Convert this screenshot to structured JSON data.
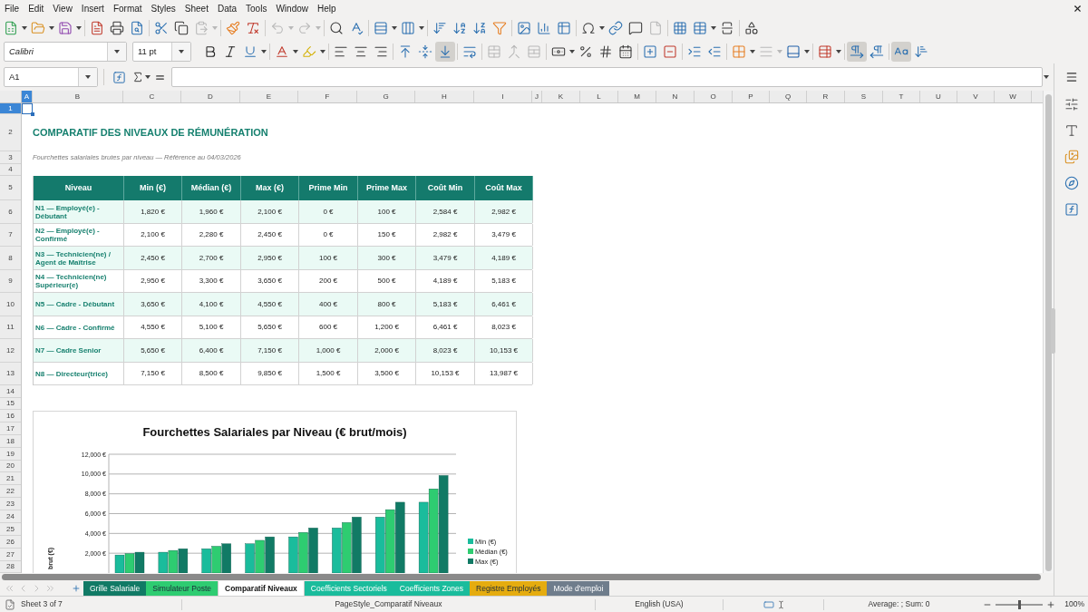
{
  "menu_bar": [
    "File",
    "Edit",
    "View",
    "Insert",
    "Format",
    "Styles",
    "Sheet",
    "Data",
    "Tools",
    "Window",
    "Help"
  ],
  "standard_toolbar": {
    "paste_disabled": true,
    "undo_disabled": true,
    "redo_disabled": true,
    "header_footer_disabled": true
  },
  "formatting_toolbar": {
    "font_name": "Calibri",
    "font_size": "11 pt",
    "merge_disabled": true,
    "border_style_disabled": true,
    "vertical_align": [
      {
        "selected": false
      },
      {
        "selected": false
      },
      {
        "selected": true
      }
    ],
    "paragraph_direction": [
      {
        "selected": true
      },
      {
        "selected": false
      }
    ],
    "text_orientation": [
      {
        "selected": true
      },
      {
        "selected": false
      }
    ]
  },
  "formula_bar": {
    "cell_reference": "A1"
  },
  "sheet": {
    "columns": [
      {
        "label": "A",
        "selected": true
      },
      {
        "label": "B",
        "selected": false
      },
      {
        "label": "C",
        "selected": false
      },
      {
        "label": "D",
        "selected": false
      },
      {
        "label": "E",
        "selected": false
      },
      {
        "label": "F",
        "selected": false
      },
      {
        "label": "G",
        "selected": false
      },
      {
        "label": "H",
        "selected": false
      },
      {
        "label": "I",
        "selected": false
      },
      {
        "label": "J",
        "selected": false
      },
      {
        "label": "K",
        "selected": false
      },
      {
        "label": "L",
        "selected": false
      },
      {
        "label": "M",
        "selected": false
      },
      {
        "label": "N",
        "selected": false
      },
      {
        "label": "O",
        "selected": false
      },
      {
        "label": "P",
        "selected": false
      },
      {
        "label": "Q",
        "selected": false
      },
      {
        "label": "R",
        "selected": false
      },
      {
        "label": "S",
        "selected": false
      },
      {
        "label": "T",
        "selected": false
      },
      {
        "label": "U",
        "selected": false
      },
      {
        "label": "V",
        "selected": false
      },
      {
        "label": "W",
        "selected": false
      }
    ],
    "rows": [
      {
        "label": "1",
        "selected": true
      },
      {
        "label": "2",
        "selected": false
      },
      {
        "label": "3",
        "selected": false
      },
      {
        "label": "4",
        "selected": false
      },
      {
        "label": "5",
        "selected": false
      },
      {
        "label": "6",
        "selected": false
      },
      {
        "label": "7",
        "selected": false
      },
      {
        "label": "8",
        "selected": false
      },
      {
        "label": "9",
        "selected": false
      },
      {
        "label": "10",
        "selected": false
      },
      {
        "label": "11",
        "selected": false
      },
      {
        "label": "12",
        "selected": false
      },
      {
        "label": "13",
        "selected": false
      },
      {
        "label": "14",
        "selected": false
      },
      {
        "label": "15",
        "selected": false
      },
      {
        "label": "16",
        "selected": false
      },
      {
        "label": "17",
        "selected": false
      },
      {
        "label": "18",
        "selected": false
      },
      {
        "label": "19",
        "selected": false
      },
      {
        "label": "20",
        "selected": false
      },
      {
        "label": "21",
        "selected": false
      },
      {
        "label": "22",
        "selected": false
      },
      {
        "label": "23",
        "selected": false
      },
      {
        "label": "24",
        "selected": false
      },
      {
        "label": "25",
        "selected": false
      },
      {
        "label": "26",
        "selected": false
      },
      {
        "label": "27",
        "selected": false
      },
      {
        "label": "28",
        "selected": false
      }
    ],
    "title": "COMPARATIF DES NIVEAUX DE RÉMUNÉRATION",
    "subtitle": "Fourchettes salariales brutes par niveau — Référence au 04/03/2026",
    "table": {
      "columns": [
        "Niveau",
        "Min (€)",
        "Médian (€)",
        "Max (€)",
        "Prime Min",
        "Prime Max",
        "Coût Min",
        "Coût Max"
      ],
      "rows": [
        [
          "N1 — Employé(e) - Débutant",
          "1,820 €",
          "1,960 €",
          "2,100 €",
          "0 €",
          "100 €",
          "2,584 €",
          "2,982 €"
        ],
        [
          "N2 — Employé(e) - Confirmé",
          "2,100 €",
          "2,280 €",
          "2,450 €",
          "0 €",
          "150 €",
          "2,982 €",
          "3,479 €"
        ],
        [
          "N3 — Technicien(ne) / Agent de Maîtrise",
          "2,450 €",
          "2,700 €",
          "2,950 €",
          "100 €",
          "300 €",
          "3,479 €",
          "4,189 €"
        ],
        [
          "N4 — Technicien(ne) Supérieur(e)",
          "2,950 €",
          "3,300 €",
          "3,650 €",
          "200 €",
          "500 €",
          "4,189 €",
          "5,183 €"
        ],
        [
          "N5 — Cadre - Débutant",
          "3,650 €",
          "4,100 €",
          "4,550 €",
          "400 €",
          "800 €",
          "5,183 €",
          "6,461 €"
        ],
        [
          "N6 — Cadre - Confirmé",
          "4,550 €",
          "5,100 €",
          "5,650 €",
          "600 €",
          "1,200 €",
          "6,461 €",
          "8,023 €"
        ],
        [
          "N7 — Cadre Senior",
          "5,650 €",
          "6,400 €",
          "7,150 €",
          "1,000 €",
          "2,000 €",
          "8,023 €",
          "10,153 €"
        ],
        [
          "N8 — Directeur(trice)",
          "7,150 €",
          "8,500 €",
          "9,850 €",
          "1,500 €",
          "3,500 €",
          "10,153 €",
          "13,987 €"
        ]
      ]
    },
    "chart": {
      "chart_data": {
        "type": "bar",
        "title": "Fourchettes Salariales par Niveau (€ brut/mois)",
        "ylabel": "brut (€)",
        "ylim": [
          0,
          12000
        ],
        "yticks": [
          {
            "value": 2000,
            "label": "2,000 €"
          },
          {
            "value": 4000,
            "label": "4,000 €"
          },
          {
            "value": 6000,
            "label": "6,000 €"
          },
          {
            "value": 8000,
            "label": "8,000 €"
          },
          {
            "value": 10000,
            "label": "10,000 €"
          },
          {
            "value": 12000,
            "label": "12,000 €"
          }
        ],
        "grid": true,
        "legend": true,
        "series": [
          {
            "name": "Min (€)",
            "color": "#1abc9c",
            "values": [
              1820,
              2100,
              2450,
              2950,
              3650,
              4550,
              5650,
              7150
            ]
          },
          {
            "name": "Médian (€)",
            "color": "#2ecc71",
            "values": [
              1960,
              2280,
              2700,
              3300,
              4100,
              5100,
              6400,
              8500
            ]
          },
          {
            "name": "Max (€)",
            "color": "#117a65",
            "values": [
              2100,
              2450,
              2950,
              3650,
              4550,
              5650,
              7150,
              9850
            ]
          }
        ]
      }
    }
  },
  "sheet_tabs": {
    "navigation_disabled": true,
    "tabs": [
      {
        "label": "Grille Salariale",
        "color": "#117a65",
        "selected": false
      },
      {
        "label": "Simulateur Poste",
        "color": "#2ecc71",
        "selected": false
      },
      {
        "label": "Comparatif Niveaux",
        "selected": true
      },
      {
        "label": "Coefficients Sectoriels",
        "color": "#1abc9c",
        "selected": false
      },
      {
        "label": "Coefficients Zones",
        "color": "#1abc9c",
        "selected": false
      },
      {
        "label": "Registre Employés",
        "color": "#e5ac0f",
        "selected": false
      },
      {
        "label": "Mode d'emploi",
        "color": "#6f7d8c",
        "selected": false
      }
    ]
  },
  "status_bar": {
    "sheet": "Sheet 3 of 7",
    "page_style": "PageStyle_Comparatif Niveaux",
    "language": "English (USA)",
    "summary": "Average: ; Sum: 0",
    "zoom": {
      "level": 0.5,
      "reading": "100%"
    }
  }
}
